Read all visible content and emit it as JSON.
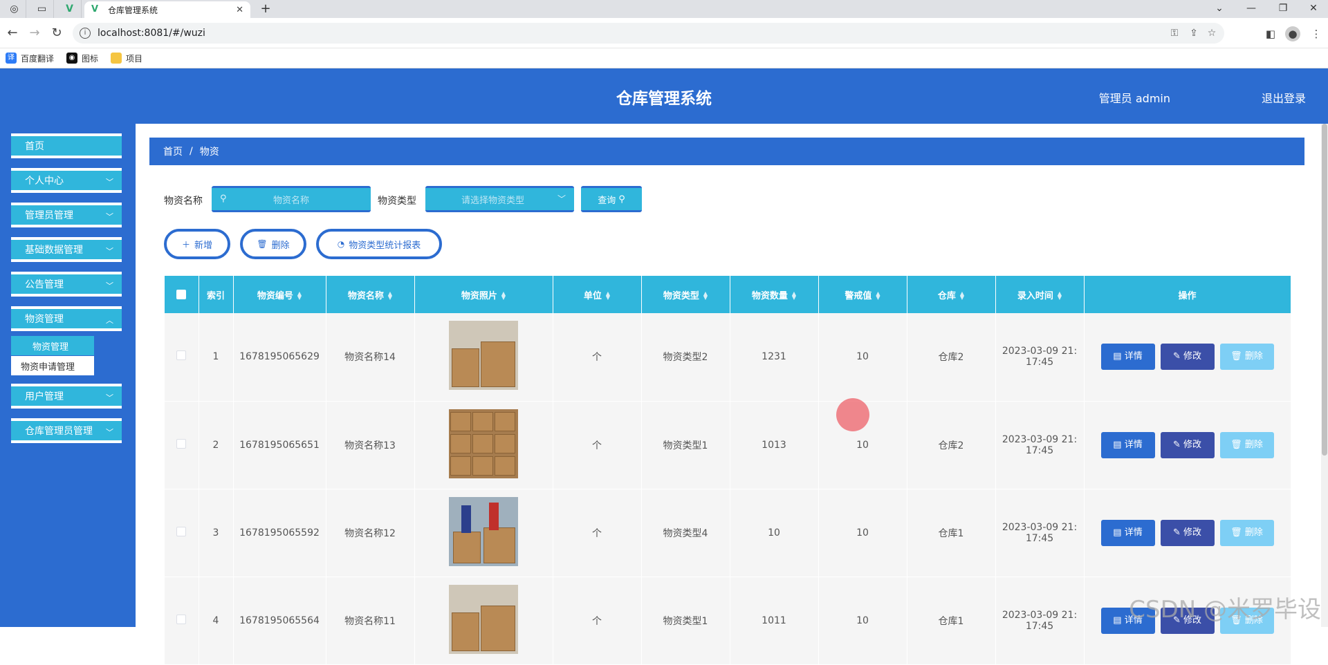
{
  "browser": {
    "tab_title": "仓库管理系统",
    "url": "localhost:8081/#/wuzi",
    "bookmarks": [
      "百度翻译",
      "图标",
      "项目"
    ]
  },
  "header": {
    "title": "仓库管理系统",
    "user": "管理员 admin",
    "logout": "退出登录"
  },
  "sidebar": {
    "items": [
      {
        "label": "首页"
      },
      {
        "label": "个人中心"
      },
      {
        "label": "管理员管理"
      },
      {
        "label": "基础数据管理"
      },
      {
        "label": "公告管理"
      },
      {
        "label": "物资管理"
      },
      {
        "label": "用户管理"
      },
      {
        "label": "仓库管理员管理"
      }
    ],
    "submenu": [
      "物资管理",
      "物资申请管理"
    ]
  },
  "breadcrumb": {
    "home": "首页",
    "sep": "/",
    "current": "物资"
  },
  "search": {
    "name_label": "物资名称",
    "name_placeholder": "物资名称",
    "type_label": "物资类型",
    "type_placeholder": "请选择物资类型",
    "query_label": "查询"
  },
  "actions": {
    "add": "新增",
    "delete": "删除",
    "report": "物资类型统计报表"
  },
  "table": {
    "headers": [
      "索引",
      "物资编号",
      "物资名称",
      "物资照片",
      "单位",
      "物资类型",
      "物资数量",
      "警戒值",
      "仓库",
      "录入时间",
      "操作"
    ],
    "rows": [
      {
        "index": "1",
        "code": "1678195065629",
        "name": "物资名称14",
        "unit": "个",
        "type": "物资类型2",
        "qty": "1231",
        "warn": "10",
        "warehouse": "仓库2",
        "time1": "2023-03-09 21:",
        "time2": "17:45"
      },
      {
        "index": "2",
        "code": "1678195065651",
        "name": "物资名称13",
        "unit": "个",
        "type": "物资类型1",
        "qty": "1013",
        "warn": "10",
        "warehouse": "仓库2",
        "time1": "2023-03-09 21:",
        "time2": "17:45"
      },
      {
        "index": "3",
        "code": "1678195065592",
        "name": "物资名称12",
        "unit": "个",
        "type": "物资类型4",
        "qty": "10",
        "warn": "10",
        "warehouse": "仓库1",
        "time1": "2023-03-09 21:",
        "time2": "17:45"
      },
      {
        "index": "4",
        "code": "1678195065564",
        "name": "物资名称11",
        "unit": "个",
        "type": "物资类型1",
        "qty": "1011",
        "warn": "10",
        "warehouse": "仓库1",
        "time1": "2023-03-09 21:",
        "time2": "17:45"
      }
    ],
    "row_actions": {
      "detail": "详情",
      "edit": "修改",
      "delete": "删除"
    }
  },
  "watermark": "CSDN @米罗毕设"
}
